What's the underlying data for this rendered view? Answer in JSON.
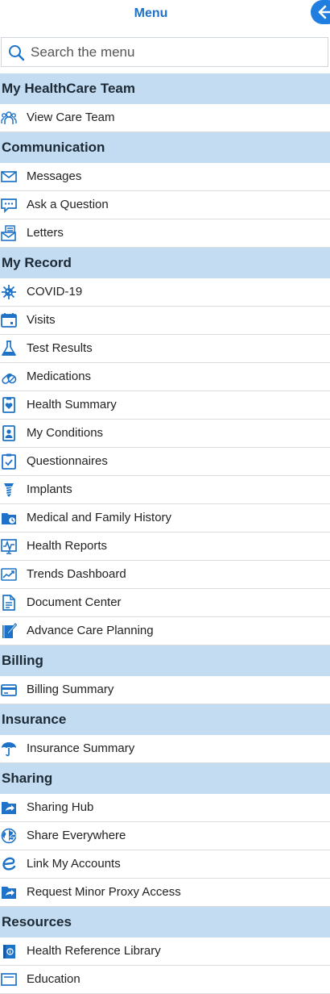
{
  "header": {
    "title": "Menu"
  },
  "search": {
    "placeholder": "Search the menu"
  },
  "sections": [
    {
      "title": "My HealthCare Team",
      "items": [
        {
          "label": "View Care Team",
          "icon": "care-team-icon"
        }
      ]
    },
    {
      "title": "Communication",
      "items": [
        {
          "label": "Messages",
          "icon": "envelope-icon"
        },
        {
          "label": "Ask a Question",
          "icon": "chat-bubble-icon"
        },
        {
          "label": "Letters",
          "icon": "letter-icon"
        }
      ]
    },
    {
      "title": "My Record",
      "items": [
        {
          "label": "COVID-19",
          "icon": "virus-icon"
        },
        {
          "label": "Visits",
          "icon": "calendar-icon"
        },
        {
          "label": "Test Results",
          "icon": "flask-icon"
        },
        {
          "label": "Medications",
          "icon": "pills-icon"
        },
        {
          "label": "Health Summary",
          "icon": "heart-badge-icon"
        },
        {
          "label": "My Conditions",
          "icon": "person-badge-icon"
        },
        {
          "label": "Questionnaires",
          "icon": "checklist-icon"
        },
        {
          "label": "Implants",
          "icon": "screw-icon"
        },
        {
          "label": "Medical and Family History",
          "icon": "folder-clock-icon"
        },
        {
          "label": "Health Reports",
          "icon": "heartbeat-chart-icon"
        },
        {
          "label": "Trends Dashboard",
          "icon": "trend-line-icon"
        },
        {
          "label": "Document Center",
          "icon": "document-icon"
        },
        {
          "label": "Advance Care Planning",
          "icon": "notebook-pen-icon"
        }
      ]
    },
    {
      "title": "Billing",
      "items": [
        {
          "label": "Billing Summary",
          "icon": "credit-card-icon"
        }
      ]
    },
    {
      "title": "Insurance",
      "items": [
        {
          "label": "Insurance Summary",
          "icon": "umbrella-icon"
        }
      ]
    },
    {
      "title": "Sharing",
      "items": [
        {
          "label": "Sharing Hub",
          "icon": "share-folder-icon"
        },
        {
          "label": "Share Everywhere",
          "icon": "globe-share-icon"
        },
        {
          "label": "Link My Accounts",
          "icon": "link-e-icon"
        },
        {
          "label": "Request Minor Proxy Access",
          "icon": "share-folder-icon"
        }
      ]
    },
    {
      "title": "Resources",
      "items": [
        {
          "label": "Health Reference Library",
          "icon": "info-book-icon"
        },
        {
          "label": "Education",
          "icon": "education-icon"
        }
      ]
    }
  ]
}
